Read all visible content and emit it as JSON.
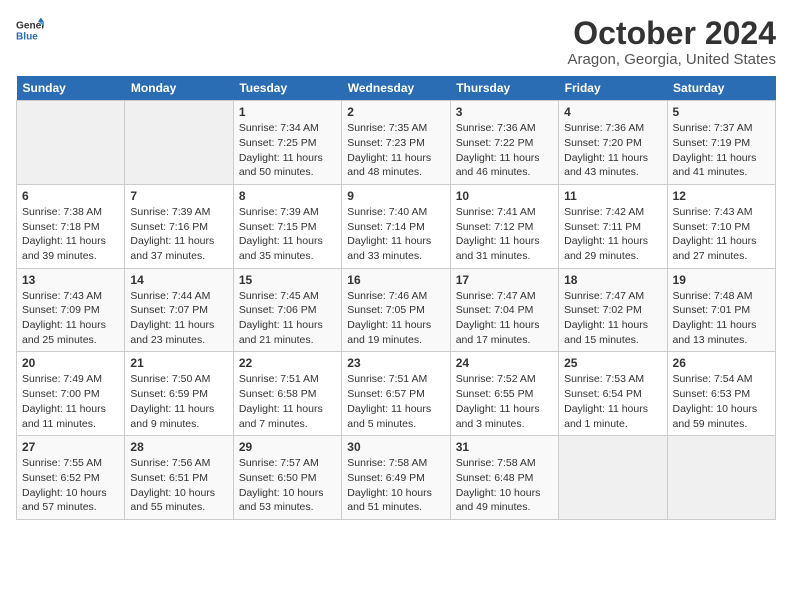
{
  "header": {
    "logo_line1": "General",
    "logo_line2": "Blue",
    "title": "October 2024",
    "subtitle": "Aragon, Georgia, United States"
  },
  "days_of_week": [
    "Sunday",
    "Monday",
    "Tuesday",
    "Wednesday",
    "Thursday",
    "Friday",
    "Saturday"
  ],
  "weeks": [
    [
      {
        "num": "",
        "info": ""
      },
      {
        "num": "",
        "info": ""
      },
      {
        "num": "1",
        "info": "Sunrise: 7:34 AM\nSunset: 7:25 PM\nDaylight: 11 hours and 50 minutes."
      },
      {
        "num": "2",
        "info": "Sunrise: 7:35 AM\nSunset: 7:23 PM\nDaylight: 11 hours and 48 minutes."
      },
      {
        "num": "3",
        "info": "Sunrise: 7:36 AM\nSunset: 7:22 PM\nDaylight: 11 hours and 46 minutes."
      },
      {
        "num": "4",
        "info": "Sunrise: 7:36 AM\nSunset: 7:20 PM\nDaylight: 11 hours and 43 minutes."
      },
      {
        "num": "5",
        "info": "Sunrise: 7:37 AM\nSunset: 7:19 PM\nDaylight: 11 hours and 41 minutes."
      }
    ],
    [
      {
        "num": "6",
        "info": "Sunrise: 7:38 AM\nSunset: 7:18 PM\nDaylight: 11 hours and 39 minutes."
      },
      {
        "num": "7",
        "info": "Sunrise: 7:39 AM\nSunset: 7:16 PM\nDaylight: 11 hours and 37 minutes."
      },
      {
        "num": "8",
        "info": "Sunrise: 7:39 AM\nSunset: 7:15 PM\nDaylight: 11 hours and 35 minutes."
      },
      {
        "num": "9",
        "info": "Sunrise: 7:40 AM\nSunset: 7:14 PM\nDaylight: 11 hours and 33 minutes."
      },
      {
        "num": "10",
        "info": "Sunrise: 7:41 AM\nSunset: 7:12 PM\nDaylight: 11 hours and 31 minutes."
      },
      {
        "num": "11",
        "info": "Sunrise: 7:42 AM\nSunset: 7:11 PM\nDaylight: 11 hours and 29 minutes."
      },
      {
        "num": "12",
        "info": "Sunrise: 7:43 AM\nSunset: 7:10 PM\nDaylight: 11 hours and 27 minutes."
      }
    ],
    [
      {
        "num": "13",
        "info": "Sunrise: 7:43 AM\nSunset: 7:09 PM\nDaylight: 11 hours and 25 minutes."
      },
      {
        "num": "14",
        "info": "Sunrise: 7:44 AM\nSunset: 7:07 PM\nDaylight: 11 hours and 23 minutes."
      },
      {
        "num": "15",
        "info": "Sunrise: 7:45 AM\nSunset: 7:06 PM\nDaylight: 11 hours and 21 minutes."
      },
      {
        "num": "16",
        "info": "Sunrise: 7:46 AM\nSunset: 7:05 PM\nDaylight: 11 hours and 19 minutes."
      },
      {
        "num": "17",
        "info": "Sunrise: 7:47 AM\nSunset: 7:04 PM\nDaylight: 11 hours and 17 minutes."
      },
      {
        "num": "18",
        "info": "Sunrise: 7:47 AM\nSunset: 7:02 PM\nDaylight: 11 hours and 15 minutes."
      },
      {
        "num": "19",
        "info": "Sunrise: 7:48 AM\nSunset: 7:01 PM\nDaylight: 11 hours and 13 minutes."
      }
    ],
    [
      {
        "num": "20",
        "info": "Sunrise: 7:49 AM\nSunset: 7:00 PM\nDaylight: 11 hours and 11 minutes."
      },
      {
        "num": "21",
        "info": "Sunrise: 7:50 AM\nSunset: 6:59 PM\nDaylight: 11 hours and 9 minutes."
      },
      {
        "num": "22",
        "info": "Sunrise: 7:51 AM\nSunset: 6:58 PM\nDaylight: 11 hours and 7 minutes."
      },
      {
        "num": "23",
        "info": "Sunrise: 7:51 AM\nSunset: 6:57 PM\nDaylight: 11 hours and 5 minutes."
      },
      {
        "num": "24",
        "info": "Sunrise: 7:52 AM\nSunset: 6:55 PM\nDaylight: 11 hours and 3 minutes."
      },
      {
        "num": "25",
        "info": "Sunrise: 7:53 AM\nSunset: 6:54 PM\nDaylight: 11 hours and 1 minute."
      },
      {
        "num": "26",
        "info": "Sunrise: 7:54 AM\nSunset: 6:53 PM\nDaylight: 10 hours and 59 minutes."
      }
    ],
    [
      {
        "num": "27",
        "info": "Sunrise: 7:55 AM\nSunset: 6:52 PM\nDaylight: 10 hours and 57 minutes."
      },
      {
        "num": "28",
        "info": "Sunrise: 7:56 AM\nSunset: 6:51 PM\nDaylight: 10 hours and 55 minutes."
      },
      {
        "num": "29",
        "info": "Sunrise: 7:57 AM\nSunset: 6:50 PM\nDaylight: 10 hours and 53 minutes."
      },
      {
        "num": "30",
        "info": "Sunrise: 7:58 AM\nSunset: 6:49 PM\nDaylight: 10 hours and 51 minutes."
      },
      {
        "num": "31",
        "info": "Sunrise: 7:58 AM\nSunset: 6:48 PM\nDaylight: 10 hours and 49 minutes."
      },
      {
        "num": "",
        "info": ""
      },
      {
        "num": "",
        "info": ""
      }
    ]
  ]
}
